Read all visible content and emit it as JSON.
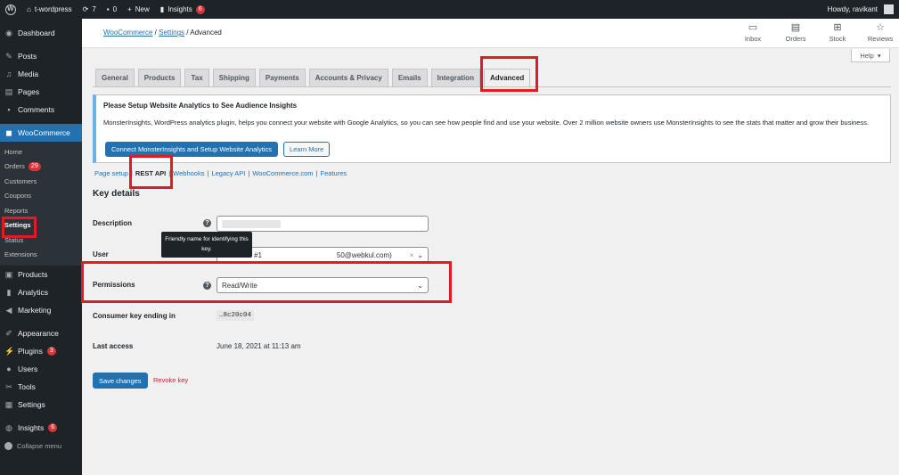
{
  "adminbar": {
    "site_name": "t-wordpress",
    "updates_count": "7",
    "comments_count": "0",
    "new_label": "New",
    "insights_label": "Insights",
    "insights_badge": "6",
    "howdy": "Howdy, ravikant"
  },
  "sidebar": {
    "dashboard": "Dashboard",
    "posts": "Posts",
    "media": "Media",
    "pages": "Pages",
    "comments": "Comments",
    "woocommerce": "WooCommerce",
    "woo_sub": {
      "home": "Home",
      "orders": "Orders",
      "orders_badge": "29",
      "customers": "Customers",
      "coupons": "Coupons",
      "reports": "Reports",
      "settings": "Settings",
      "status": "Status",
      "extensions": "Extensions"
    },
    "products": "Products",
    "analytics": "Analytics",
    "marketing": "Marketing",
    "appearance": "Appearance",
    "plugins": "Plugins",
    "plugins_badge": "3",
    "users": "Users",
    "tools": "Tools",
    "settings": "Settings",
    "insights": "Insights",
    "insights_badge": "6",
    "collapse": "Collapse menu"
  },
  "header": {
    "crumb_woocommerce": "WooCommerce",
    "crumb_settings": "Settings",
    "crumb_current": "Advanced",
    "actions": {
      "inbox": "Inbox",
      "orders": "Orders",
      "stock": "Stock",
      "reviews": "Reviews"
    },
    "help": "Help"
  },
  "tabs": {
    "general": "General",
    "products": "Products",
    "tax": "Tax",
    "shipping": "Shipping",
    "payments": "Payments",
    "accounts": "Accounts & Privacy",
    "emails": "Emails",
    "integration": "Integration",
    "advanced": "Advanced"
  },
  "notice": {
    "title": "Please Setup Website Analytics to See Audience Insights",
    "text": "MonsterInsights, WordPress analytics plugin, helps you connect your website with Google Analytics, so you can see how people find and use your website. Over 2 million website owners use MonsterInsights to see the stats that matter and grow their business.",
    "connect_btn": "Connect MonsterInsights and Setup Website Analytics",
    "learn_btn": "Learn More"
  },
  "subsub": {
    "page_setup": "Page setup",
    "rest_api": "REST API",
    "webhooks": "Webhooks",
    "legacy_api": "Legacy API",
    "woocommerce_com": "WooCommerce.com",
    "features": "Features",
    "separator": "|"
  },
  "form": {
    "section_title": "Key details",
    "description_label": "Description",
    "tooltip": "Friendly name for identifying this key.",
    "user_label": "User",
    "user_value_prefix": "#1",
    "user_value_suffix": "50@webkul.com)",
    "permissions_label": "Permissions",
    "permissions_value": "Read/Write",
    "consumer_label": "Consumer key ending in",
    "consumer_value": "…8c20c04",
    "last_access_label": "Last access",
    "last_access_value": "June 18, 2021 at 11:13 am",
    "save_btn": "Save changes",
    "revoke_link": "Revoke key"
  }
}
